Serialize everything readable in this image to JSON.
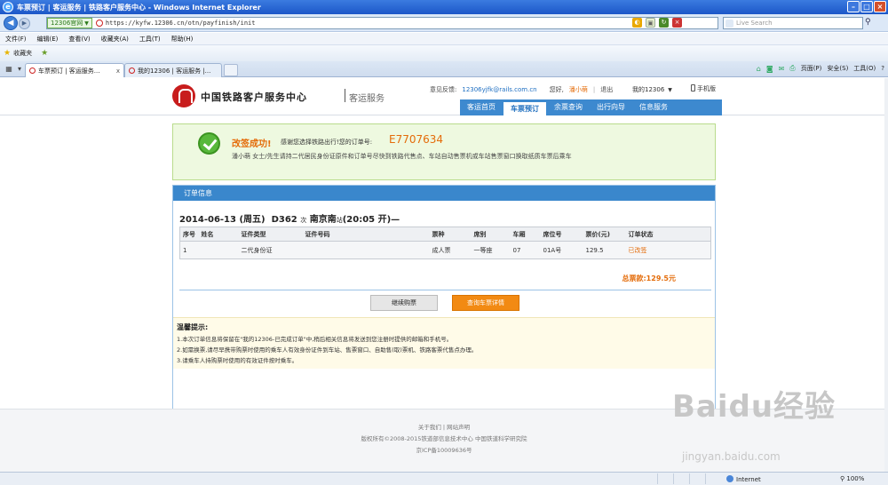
{
  "window": {
    "title": "车票预订 | 客运服务 | 铁路客户服务中心 - Windows Internet Explorer"
  },
  "address_bar": {
    "site_badge": "12306官网",
    "url": "https://kyfw.12306.cn/otn/payfinish/init",
    "search_placeholder": "Live Search"
  },
  "menu": [
    "文件(F)",
    "编辑(E)",
    "查看(V)",
    "收藏夹(A)",
    "工具(T)",
    "帮助(H)"
  ],
  "favorites": {
    "label": "收藏夹"
  },
  "tabs": [
    {
      "label": "车票预订 | 客运服务...",
      "close": "x"
    },
    {
      "label": "我的12306 | 客运服务 |...",
      "close": ""
    }
  ],
  "command_bar": {
    "page": "页面(P)",
    "safety": "安全(S)",
    "tools": "工具(O)",
    "help": "?"
  },
  "site": {
    "name": "中国铁路客户服务中心",
    "sub": "客运服务",
    "feedback_label": "意见反馈:",
    "feedback_email": "12306yjfk@rails.com.cn",
    "greeting": "您好,",
    "user": "潘小萌",
    "logout": "退出",
    "my12306": "我的12306",
    "mobile": "手机版"
  },
  "nav": [
    "客运首页",
    "车票预订",
    "余票查询",
    "出行向导",
    "信息服务"
  ],
  "nav_active": 1,
  "success": {
    "title": "改签成功!",
    "thanks": "感谢您选择铁路出行!您的订单号:",
    "order_no": "E7707634",
    "note": "潘小萌 女士/先生请持二代居民身份证原件和订单号尽快到铁路代售点、车站自动售票机或车站售票窗口换取纸质车票后乘车"
  },
  "order": {
    "panel_title": "订单信息",
    "date": "2014-06-13",
    "weekday": "(周五)",
    "train": "D362",
    "train_suffix": "次",
    "station": "南京南",
    "station_suffix": "站",
    "time": "(20:05 开)—",
    "columns": [
      "序号",
      "姓名",
      "证件类型",
      "证件号码",
      "票种",
      "席别",
      "车厢",
      "席位号",
      "票价(元)",
      "订单状态"
    ],
    "rows": [
      {
        "no": "1",
        "name": "",
        "id_type": "二代身份证",
        "id_no": "",
        "ticket_type": "成人票",
        "seat_class": "一等座",
        "coach": "07",
        "seat": "01A号",
        "price": "129.5",
        "status": "已改签"
      }
    ],
    "total": "总票款:129.5元",
    "btn_continue": "继续购票",
    "btn_detail": "查询车票详情"
  },
  "tips": {
    "title": "温馨提示:",
    "lines": [
      "1.本次订单信息将保留在\"我的12306-已完成订单\"中,稍后相关信息将发送到您注册时提供的邮箱和手机号。",
      "2.如需换票,请尽早携带购票时使用的乘车人有效身份证件到车站、售票窗口、自助售(取)票机、铁路客票代售点办理。",
      "3.请乘车人持购票时使用的有效证件按时乘车。"
    ]
  },
  "footer": {
    "links": "关于我们 | 网站声明",
    "copyright": "版权所有©2008-2015铁道部信息技术中心  中国铁道科学研究院",
    "icp": "京ICP备10009636号"
  },
  "watermark": {
    "text": "Baidu经验",
    "sub": "jingyan.baidu.com"
  },
  "status": {
    "zone": "Internet",
    "zoom": "100%"
  },
  "colors": {
    "accent": "#3a87cc",
    "orange": "#e46c0a",
    "success_bg": "#eef9e0",
    "title_bar": "#1c57c8"
  }
}
